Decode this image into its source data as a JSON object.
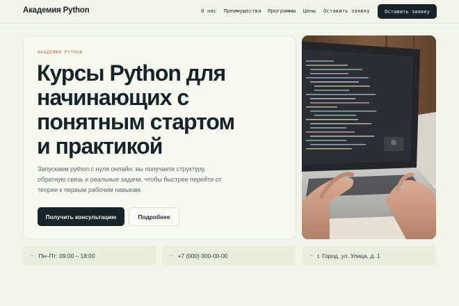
{
  "header": {
    "logo": "Академия Python",
    "nav": [
      {
        "label": "О нас"
      },
      {
        "label": "Преимущества"
      },
      {
        "label": "Программы"
      },
      {
        "label": "Цены"
      },
      {
        "label": "Оставить заявку"
      }
    ],
    "cta": "Оставить заявку"
  },
  "hero": {
    "eyebrow": "АКАДЕМИЯ PYTHON",
    "title_lines": [
      "Курсы Python для",
      "начинающих с",
      "понятным стартом",
      "и практикой"
    ],
    "lead_lines": [
      "Запускаем python с нуля онлайн: вы получаете структуру,",
      "обратную связь и реальные задачи, чтобы быстрее перейти от",
      "теории к первым рабочим навыкам."
    ],
    "primary_button": "Получить консультацию",
    "secondary_button": "Подробнее"
  },
  "info": [
    {
      "icon": "dash-icon",
      "text": "Пн–Пт: 09:00 – 18:00"
    },
    {
      "icon": "dash-icon",
      "text": "+7 (000) 000-00-00"
    },
    {
      "icon": "dash-icon",
      "text": "г. Город, ул. Улица, д. 1"
    }
  ],
  "info_marker": "–",
  "colors": {
    "background": "#f2f6ea",
    "dark": "#17232b",
    "accent": "#c06a48",
    "info_card": "#e9efdc"
  }
}
